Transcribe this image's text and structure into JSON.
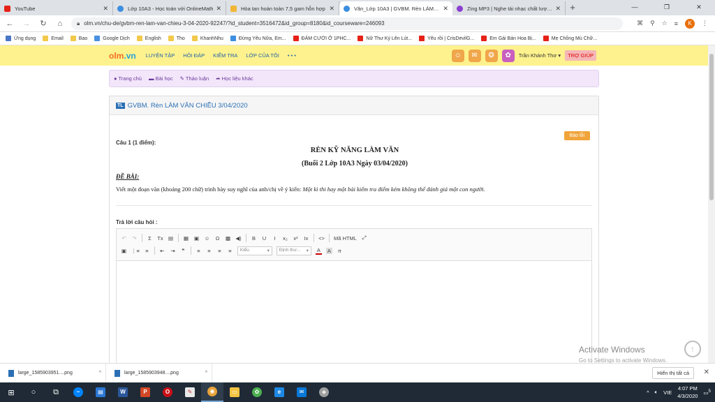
{
  "browser": {
    "tabs": [
      {
        "title": "YouTube",
        "color": "#e62117"
      },
      {
        "title": "Lớp 10A3 - Học toán với OnlineMath",
        "color": "#3b8ee0"
      },
      {
        "title": "Hòa tan hoàn toàn 7,5 gam hỗn hợp",
        "color": "#f2b636"
      },
      {
        "title": "Văn_Lớp 10A3 | GVBM. Rèn LÀM VĂN",
        "color": "#3b8ee0"
      },
      {
        "title": "Zing MP3 | Nghe tải nhạc chất lượng",
        "color": "#8a3fd1"
      }
    ],
    "new_tab": "+",
    "url": "olm.vn/chu-de/gvbm-ren-lam-van-chieu-3-04-2020-92247/?id_student=3516472&id_group=8180&id_courseware=246093",
    "profile_initial": "K"
  },
  "bookmarks": [
    {
      "label": "Ứng dụng",
      "color": "#4a76c7"
    },
    {
      "label": "Email",
      "color": "#f2c94c"
    },
    {
      "label": "Bao",
      "color": "#f2c94c"
    },
    {
      "label": "Google Dịch",
      "color": "#4a90e2"
    },
    {
      "label": "English",
      "color": "#f2c94c"
    },
    {
      "label": "Tho",
      "color": "#f2c94c"
    },
    {
      "label": "KhanhNhu",
      "color": "#f2c94c"
    },
    {
      "label": "Đừng Yêu Nữa, Em...",
      "color": "#3b8ee0"
    },
    {
      "label": "ĐÁM CƯỚI Ở 1PHC...",
      "color": "#e62117"
    },
    {
      "label": "Nữ Thư Ký Lên Lút...",
      "color": "#e62117"
    },
    {
      "label": "Yêu rồi | CrisDevilG...",
      "color": "#e62117"
    },
    {
      "label": "Em Gái Bán Hoa Bị...",
      "color": "#e62117"
    },
    {
      "label": "Mẹ Chồng Mù Chữ...",
      "color": "#e62117"
    }
  ],
  "site": {
    "logo_main": "olm",
    "logo_dot": ".",
    "logo_tld": "vn",
    "nav": [
      "LUYỆN TẬP",
      "HỎI ĐÁP",
      "KIỂM TRA",
      "LỚP CỦA TÔI",
      "• • •"
    ],
    "user_name": "Trần Khánh Thơ",
    "help_label": "TRỢ GIÚP"
  },
  "subnav": [
    {
      "icon": "●",
      "label": "Trang chủ"
    },
    {
      "icon": "▬",
      "label": "Bài học"
    },
    {
      "icon": "✎",
      "label": "Thảo luận"
    },
    {
      "icon": "➦",
      "label": "Học liệu khác"
    }
  ],
  "panel": {
    "badge": "TL",
    "title": "GVBM. Rèn LÀM VĂN CHIỀU 3/04/2020",
    "report_label": "Báo lỗi",
    "question_label": "Câu 1 (1 điểm):",
    "heading": "RÈN KỸ NĂNG LÀM VĂN",
    "subheading": "(Buổi 2  Lớp 10A3  Ngày 03/04/2020)",
    "de_bai": "ĐỀ BÀI:",
    "prompt_plain": "Viết một đoạn văn (khoảng 200 chữ) trình bày suy nghĩ của anh/chị về ý kiến: ",
    "prompt_italic": "Một kì thi hay một bài kiểm tra điểm kém không thể đánh giá một con người.",
    "answer_label": "Trả lời câu hỏi :"
  },
  "editor": {
    "row1": [
      "↶",
      "↷",
      "|",
      "Σ",
      "Tx",
      "▤",
      "|",
      "▦",
      "▣",
      "☺",
      "Ω",
      "▩",
      "◀)",
      "|",
      "B",
      "U",
      "I",
      "x₂",
      "x²",
      "Ix",
      "|",
      "<>",
      "|",
      "Mã HTML",
      "⤢"
    ],
    "row2": [
      "▣",
      "⋮≡",
      "≡",
      "|",
      "⇤",
      "⇥",
      "❞",
      "|",
      "≡",
      "≡",
      "≡",
      "≡"
    ],
    "style_select": "Kiểu",
    "format_select": "Định thư...",
    "font_color": "A",
    "bg_color": "A",
    "math": "π"
  },
  "watermark": {
    "line1": "Activate Windows",
    "line2": "Go to Settings to activate Windows."
  },
  "downloads": {
    "items": [
      "large_1585903951....png",
      "large_1585903948....png"
    ],
    "show_all": "Hiển thị tất cả"
  },
  "taskbar": {
    "lang": "VIE",
    "time": "4:07 PM",
    "date": "4/3/2020",
    "notify_count": "5"
  }
}
